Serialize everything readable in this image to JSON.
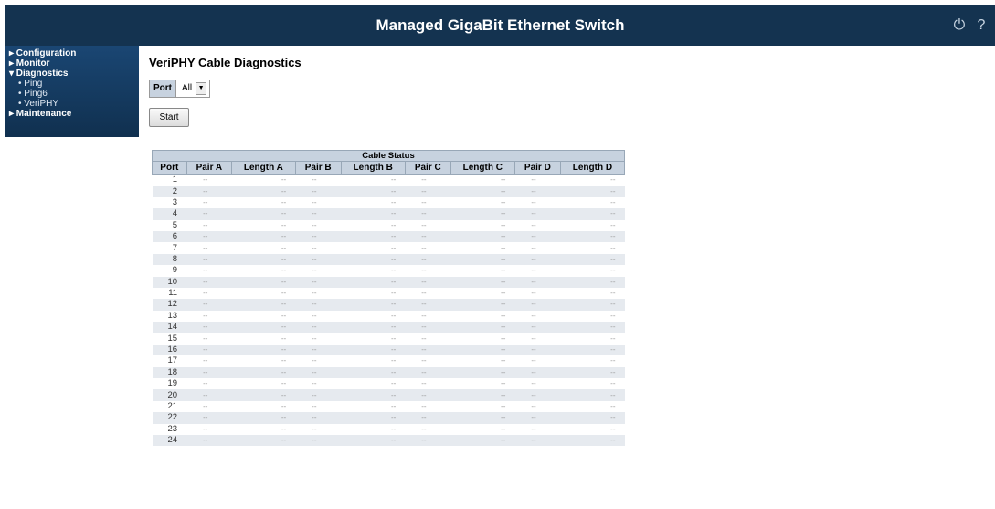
{
  "header": {
    "title": "Managed GigaBit Ethernet Switch",
    "icons": [
      "logout-icon",
      "help-icon"
    ]
  },
  "sidebar": {
    "items": [
      {
        "label": "▸ Configuration"
      },
      {
        "label": "▸ Monitor"
      },
      {
        "label": "▾ Diagnostics"
      },
      {
        "label": "• Ping"
      },
      {
        "label": "• Ping6"
      },
      {
        "label": "• VeriPHY"
      },
      {
        "label": "▸ Maintenance"
      }
    ]
  },
  "page": {
    "title": "VeriPHY Cable Diagnostics",
    "port_label": "Port",
    "port_value": "All",
    "start_label": "Start"
  },
  "table": {
    "caption": "Cable Status",
    "columns": [
      "Port",
      "Pair A",
      "Length A",
      "Pair B",
      "Length B",
      "Pair C",
      "Length C",
      "Pair D",
      "Length D"
    ],
    "rows": [
      [
        "1",
        "--",
        "--",
        "--",
        "--",
        "--",
        "--",
        "--",
        "--"
      ],
      [
        "2",
        "--",
        "--",
        "--",
        "--",
        "--",
        "--",
        "--",
        "--"
      ],
      [
        "3",
        "--",
        "--",
        "--",
        "--",
        "--",
        "--",
        "--",
        "--"
      ],
      [
        "4",
        "--",
        "--",
        "--",
        "--",
        "--",
        "--",
        "--",
        "--"
      ],
      [
        "5",
        "--",
        "--",
        "--",
        "--",
        "--",
        "--",
        "--",
        "--"
      ],
      [
        "6",
        "--",
        "--",
        "--",
        "--",
        "--",
        "--",
        "--",
        "--"
      ],
      [
        "7",
        "--",
        "--",
        "--",
        "--",
        "--",
        "--",
        "--",
        "--"
      ],
      [
        "8",
        "--",
        "--",
        "--",
        "--",
        "--",
        "--",
        "--",
        "--"
      ],
      [
        "9",
        "--",
        "--",
        "--",
        "--",
        "--",
        "--",
        "--",
        "--"
      ],
      [
        "10",
        "--",
        "--",
        "--",
        "--",
        "--",
        "--",
        "--",
        "--"
      ],
      [
        "11",
        "--",
        "--",
        "--",
        "--",
        "--",
        "--",
        "--",
        "--"
      ],
      [
        "12",
        "--",
        "--",
        "--",
        "--",
        "--",
        "--",
        "--",
        "--"
      ],
      [
        "13",
        "--",
        "--",
        "--",
        "--",
        "--",
        "--",
        "--",
        "--"
      ],
      [
        "14",
        "--",
        "--",
        "--",
        "--",
        "--",
        "--",
        "--",
        "--"
      ],
      [
        "15",
        "--",
        "--",
        "--",
        "--",
        "--",
        "--",
        "--",
        "--"
      ],
      [
        "16",
        "--",
        "--",
        "--",
        "--",
        "--",
        "--",
        "--",
        "--"
      ],
      [
        "17",
        "--",
        "--",
        "--",
        "--",
        "--",
        "--",
        "--",
        "--"
      ],
      [
        "18",
        "--",
        "--",
        "--",
        "--",
        "--",
        "--",
        "--",
        "--"
      ],
      [
        "19",
        "--",
        "--",
        "--",
        "--",
        "--",
        "--",
        "--",
        "--"
      ],
      [
        "20",
        "--",
        "--",
        "--",
        "--",
        "--",
        "--",
        "--",
        "--"
      ],
      [
        "21",
        "--",
        "--",
        "--",
        "--",
        "--",
        "--",
        "--",
        "--"
      ],
      [
        "22",
        "--",
        "--",
        "--",
        "--",
        "--",
        "--",
        "--",
        "--"
      ],
      [
        "23",
        "--",
        "--",
        "--",
        "--",
        "--",
        "--",
        "--",
        "--"
      ],
      [
        "24",
        "--",
        "--",
        "--",
        "--",
        "--",
        "--",
        "--",
        "--"
      ]
    ]
  }
}
